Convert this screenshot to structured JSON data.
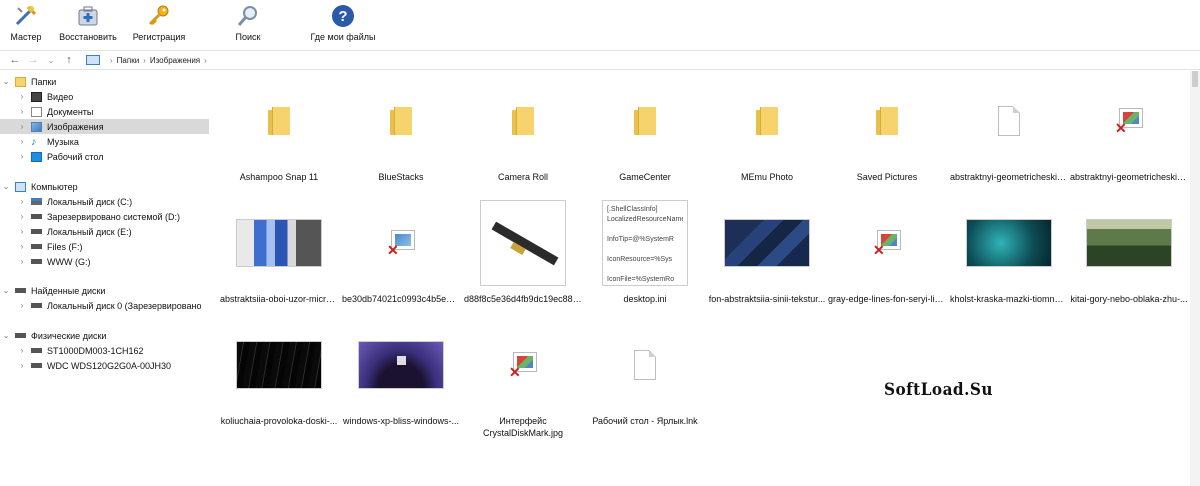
{
  "toolbar": {
    "items": [
      {
        "label": "Мастер",
        "icon": "wizard-icon"
      },
      {
        "label": "Восстановить",
        "icon": "restore-icon"
      },
      {
        "label": "Регистрация",
        "icon": "key-icon"
      },
      {
        "label": "Поиск",
        "icon": "magnifier-icon"
      },
      {
        "label": "Где мои файлы",
        "icon": "help-icon"
      }
    ]
  },
  "address": {
    "crumbs": [
      "Папки",
      "Изображения"
    ]
  },
  "sidebar": {
    "items": [
      {
        "label": "Папки",
        "icon": "folder-icon",
        "expanded": true
      },
      {
        "label": "Видео",
        "icon": "video-icon"
      },
      {
        "label": "Документы",
        "icon": "documents-icon"
      },
      {
        "label": "Изображения",
        "icon": "pictures-icon",
        "selected": true
      },
      {
        "label": "Музыка",
        "icon": "music-icon"
      },
      {
        "label": "Рабочий стол",
        "icon": "desktop-icon"
      },
      {
        "label": "Компьютер",
        "icon": "computer-icon",
        "expanded": true
      },
      {
        "label": "Локальный диск (C:)",
        "icon": "system-drive-icon"
      },
      {
        "label": "Зарезервировано системой (D:)",
        "icon": "drive-icon"
      },
      {
        "label": "Локальный диск (E:)",
        "icon": "drive-icon"
      },
      {
        "label": "Files (F:)",
        "icon": "drive-icon"
      },
      {
        "label": "WWW (G:)",
        "icon": "drive-icon"
      },
      {
        "label": "Найденные диски",
        "icon": "drive-icon",
        "expanded": true
      },
      {
        "label": "Локальный диск 0 (Зарезервировано",
        "icon": "drive-icon"
      },
      {
        "label": "Физические диски",
        "icon": "drive-icon",
        "expanded": true
      },
      {
        "label": "ST1000DM003-1CH162",
        "icon": "drive-icon"
      },
      {
        "label": "WDC WDS120G2G0A-00JH30",
        "icon": "drive-icon"
      }
    ]
  },
  "files": [
    {
      "name": "Ashampoo Snap 11",
      "kind": "folder"
    },
    {
      "name": "BlueStacks",
      "kind": "folder"
    },
    {
      "name": "Camera Roll",
      "kind": "folder"
    },
    {
      "name": "GameCenter",
      "kind": "folder"
    },
    {
      "name": "MEmu Photo",
      "kind": "folder"
    },
    {
      "name": "Saved Pictures",
      "kind": "folder"
    },
    {
      "name": "abstraktnyi-geometricheskii-...",
      "kind": "doc"
    },
    {
      "name": "abstraktnyi-geometricheskii-...",
      "kind": "broken"
    },
    {
      "name": "abstraktsiia-oboi-uzor-micro...",
      "kind": "image-a"
    },
    {
      "name": "be30db74021c0993c4b5e03f7...",
      "kind": "broken"
    },
    {
      "name": "d88f8c5e36d4fb9dc19ec8892...",
      "kind": "image-gun"
    },
    {
      "name": "desktop.ini",
      "kind": "text"
    },
    {
      "name": "fon-abstraktsiia-sinii-tekstur...",
      "kind": "image-blue"
    },
    {
      "name": "gray-edge-lines-fon-seryi-lin...",
      "kind": "broken"
    },
    {
      "name": "kholst-kraska-mazki-tiomnyi...",
      "kind": "image-teal"
    },
    {
      "name": "kitai-gory-nebo-oblaka-zhu-...",
      "kind": "image-forest"
    },
    {
      "name": "koliuchaia-provoloka-doski-...",
      "kind": "image-dark"
    },
    {
      "name": "windows-xp-bliss-windows-...",
      "kind": "image-win"
    },
    {
      "name": "Интерфейс CrystalDiskMark.jpg",
      "kind": "broken"
    },
    {
      "name": "Рабочий стол - Ярлык.lnk",
      "kind": "doc"
    }
  ],
  "desktop_ini_preview": [
    "[.ShellClassInfo]",
    "LocalizedResourceName",
    "",
    "InfoTip=@%SystemR",
    "",
    "IconResource=%Sys",
    "",
    "IconFile=%SystemRo"
  ],
  "watermark": "SoftLoad.Su",
  "colors": {
    "folder": "#f6d36d",
    "selection": "#d9d9d9",
    "accent": "#3a7fc9"
  }
}
